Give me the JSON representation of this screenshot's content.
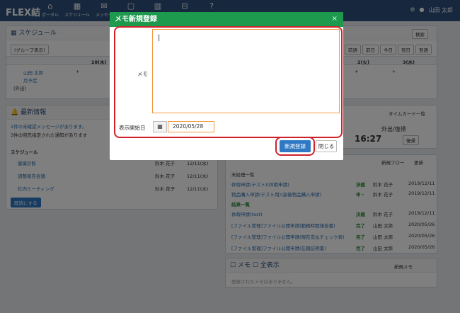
{
  "app": {
    "logo": "FLEX結",
    "user": "山田 太郎"
  },
  "nav": [
    {
      "label": "ポータル",
      "icon": "⌂"
    },
    {
      "label": "スケジュール",
      "icon": "▦"
    },
    {
      "label": "メッセー",
      "icon": "✉"
    },
    {
      "label": "",
      "icon": "▢"
    },
    {
      "label": "",
      "icon": "▥"
    },
    {
      "label": "",
      "icon": "⊟"
    },
    {
      "label": "",
      "icon": "?"
    }
  ],
  "schedule": {
    "title": "スケジュール",
    "group": "(グループ表示)",
    "search": "検索",
    "prev_week": "前週",
    "prev_day": "前日",
    "today": "今日",
    "next_day": "翌日",
    "next_week": "翌週",
    "col1": "28(木)",
    "col_tue": "2(火)",
    "col_wed": "3(水)",
    "person": "山田 太郎",
    "monthly": "月予定",
    "away": "(外出)"
  },
  "info": {
    "title": "最新情報",
    "unread": "2件の未確認メッセージがあります。",
    "notice": "3件の宛先指定された通知があります",
    "section": "スケジュール",
    "rows": [
      {
        "title": "健康診断",
        "owner": "鈴木 花子",
        "date": "12/11(水)"
      },
      {
        "title": "調整報告会議",
        "owner": "鈴木 花子",
        "date": "12/11(水)"
      },
      {
        "title": "社内ミーティング",
        "owner": "鈴木 花子",
        "date": "12/11(水)"
      }
    ],
    "confirm": "既読にする"
  },
  "timecard": {
    "label": "タイムカード一覧",
    "out": "外出/復帰",
    "time": "16:27",
    "btn": "復帰"
  },
  "workflow": {
    "title": "ワークフロー",
    "new": "新規フロー",
    "refresh": "更新",
    "pending": "未処理一覧",
    "done": "結果一覧",
    "rows": [
      {
        "name": "休暇申請(テスト)(休暇申請)",
        "status": "決裁",
        "user": "鈴木 花子",
        "date": "2019/12/11"
      },
      {
        "name": "物品購入申請(テスト用)(高価物品購入申請)",
        "status": "申・",
        "user": "鈴木 花子",
        "date": "2019/12/11"
      },
      {
        "name": "休暇申請(test)",
        "status": "決裁",
        "user": "鈴木 花子",
        "date": "2019/12/11"
      },
      {
        "name": "[ファイル管理]ファイル公開申請(勤務時間報告書)",
        "status": "完了",
        "user": "山田 太郎",
        "date": "2020/05/26"
      },
      {
        "name": "[ファイル管理]ファイル公開申請(現在支払チェック表)",
        "status": "完了",
        "user": "山田 太郎",
        "date": "2020/05/26"
      },
      {
        "name": "[ファイル管理]ファイル公開申請(在籍証明書)",
        "status": "完了",
        "user": "山田 太郎",
        "date": "2020/05/26"
      }
    ]
  },
  "memo": {
    "title": "メモ",
    "show_all": "全表示",
    "new": "新規メモ",
    "empty": "登録されたメモはありません。"
  },
  "modal": {
    "title": "メモ新規登録",
    "memo_label": "メモ",
    "date_label": "表示開始日",
    "date_value": "2020/05/28",
    "save": "新規登録",
    "close": "閉じる"
  },
  "colors": {
    "accent": "#1e9a4e",
    "primary": "#2f79c4",
    "highlight": "#d0212a"
  }
}
